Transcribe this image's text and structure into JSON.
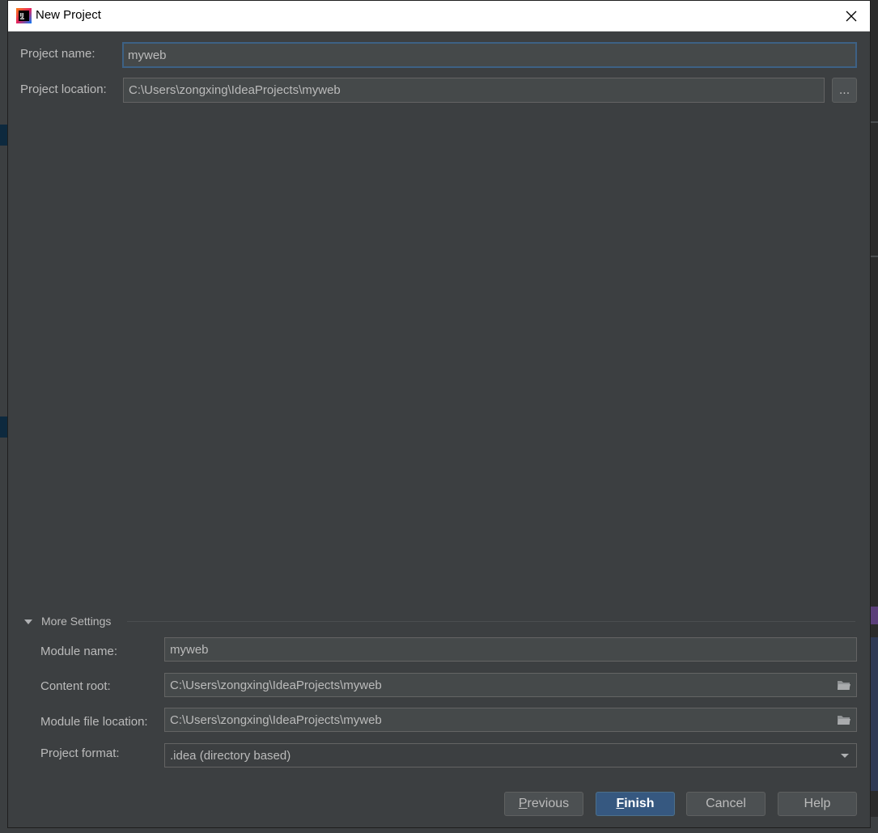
{
  "window": {
    "title": "New Project"
  },
  "form": {
    "project_name_label": "Project name:",
    "project_name_value": "myweb",
    "project_location_label": "Project location:",
    "project_location_value": "C:\\Users\\zongxing\\IdeaProjects\\myweb",
    "browse_label": "..."
  },
  "more_settings": {
    "label": "More Settings",
    "module_name_label": "Module name:",
    "module_name_value": "myweb",
    "content_root_label": "Content root:",
    "content_root_value": "C:\\Users\\zongxing\\IdeaProjects\\myweb",
    "module_file_location_label": "Module file location:",
    "module_file_location_value": "C:\\Users\\zongxing\\IdeaProjects\\myweb",
    "project_format_label": "Project format:",
    "project_format_value": ".idea (directory based)"
  },
  "buttons": {
    "previous_first": "P",
    "previous_rest": "revious",
    "finish_first": "F",
    "finish_rest": "inish",
    "cancel": "Cancel",
    "help": "Help"
  },
  "icons": {
    "app": "intellij-idea-icon",
    "close": "close-icon",
    "expand": "triangle-down-icon",
    "folder": "folder-icon",
    "dropdown": "chevron-down-icon"
  },
  "colors": {
    "dialog_bg": "#3c3f41",
    "field_bg": "#45494a",
    "primary_button": "#365880",
    "focus_border": "#3d6185"
  }
}
